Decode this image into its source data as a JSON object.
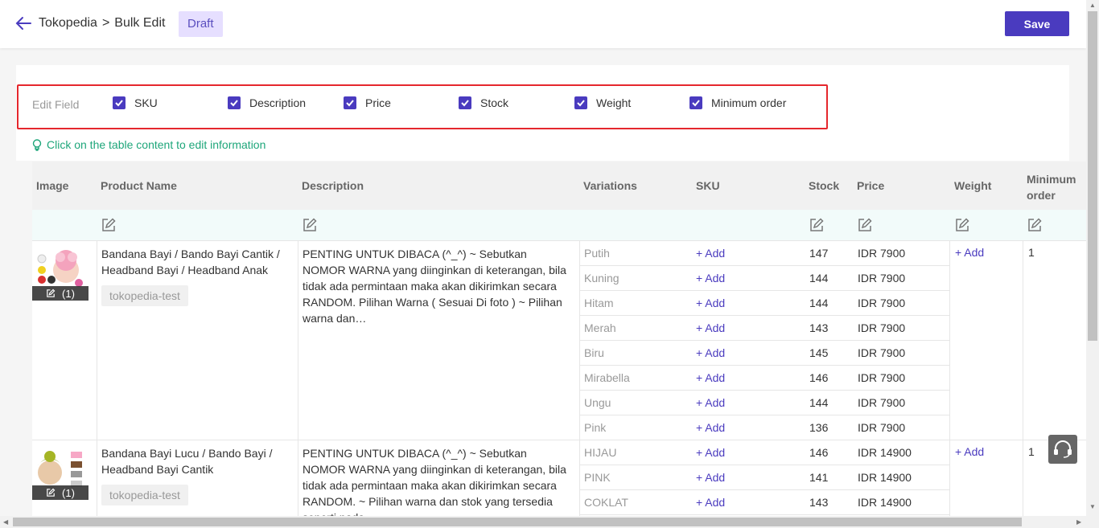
{
  "header": {
    "breadcrumb_app": "Tokopedia",
    "breadcrumb_sep": ">",
    "breadcrumb_page": "Bulk Edit",
    "status": "Draft",
    "save_label": "Save"
  },
  "edit_fields": {
    "label": "Edit Field",
    "options": [
      {
        "label": "SKU",
        "checked": true
      },
      {
        "label": "Description",
        "checked": true
      },
      {
        "label": "Price",
        "checked": true
      },
      {
        "label": "Stock",
        "checked": true
      },
      {
        "label": "Weight",
        "checked": true
      },
      {
        "label": "Minimum order",
        "checked": true
      }
    ]
  },
  "tip": "Click on the table content to edit information",
  "table": {
    "columns": [
      "Image",
      "Product Name",
      "Description",
      "Variations",
      "SKU",
      "Stock",
      "Price",
      "Weight",
      "Minimum",
      "order"
    ],
    "add_label": "+ Add",
    "products": [
      {
        "image_count": "(1)",
        "name": "Bandana Bayi / Bando Bayi Cantik / Headband Bayi / Headband Anak",
        "tag": "tokopedia-test",
        "description": "PENTING UNTUK DIBACA (^_^) ~ Sebutkan NOMOR WARNA yang diinginkan di keterangan, bila tidak ada permintaan maka akan dikirimkan secara RANDOM. Pilihan Warna ( Sesuai Di foto ) ~ Pilihan warna dan…",
        "weight_add": "+ Add",
        "min_order": "1",
        "variations": [
          {
            "name": "Putih",
            "sku": "+ Add",
            "stock": "147",
            "price": "IDR 7900"
          },
          {
            "name": "Kuning",
            "sku": "+ Add",
            "stock": "144",
            "price": "IDR 7900"
          },
          {
            "name": "Hitam",
            "sku": "+ Add",
            "stock": "144",
            "price": "IDR 7900"
          },
          {
            "name": "Merah",
            "sku": "+ Add",
            "stock": "143",
            "price": "IDR 7900"
          },
          {
            "name": "Biru",
            "sku": "+ Add",
            "stock": "145",
            "price": "IDR 7900"
          },
          {
            "name": "Mirabella",
            "sku": "+ Add",
            "stock": "146",
            "price": "IDR 7900"
          },
          {
            "name": "Ungu",
            "sku": "+ Add",
            "stock": "144",
            "price": "IDR 7900"
          },
          {
            "name": "Pink",
            "sku": "+ Add",
            "stock": "136",
            "price": "IDR 7900"
          }
        ]
      },
      {
        "image_count": "(1)",
        "name": "Bandana Bayi Lucu / Bando Bayi / Headband Bayi Cantik",
        "tag": "tokopedia-test",
        "description": "PENTING UNTUK DIBACA (^_^) ~ Sebutkan NOMOR WARNA yang diinginkan di keterangan, bila tidak ada permintaan maka akan dikirimkan secara RANDOM. ~ Pilihan warna dan stok yang tersedia seperti pada…",
        "weight_add": "+ Add",
        "min_order": "1",
        "variations": [
          {
            "name": "HIJAU",
            "sku": "+ Add",
            "stock": "146",
            "price": "IDR 14900"
          },
          {
            "name": "PINK",
            "sku": "+ Add",
            "stock": "141",
            "price": "IDR 14900"
          },
          {
            "name": "COKLAT",
            "sku": "+ Add",
            "stock": "143",
            "price": "IDR 14900"
          }
        ]
      }
    ]
  },
  "colors": {
    "accent": "#4a3bbf",
    "highlight_border": "#e5272d",
    "tip_green": "#1ea67a"
  }
}
